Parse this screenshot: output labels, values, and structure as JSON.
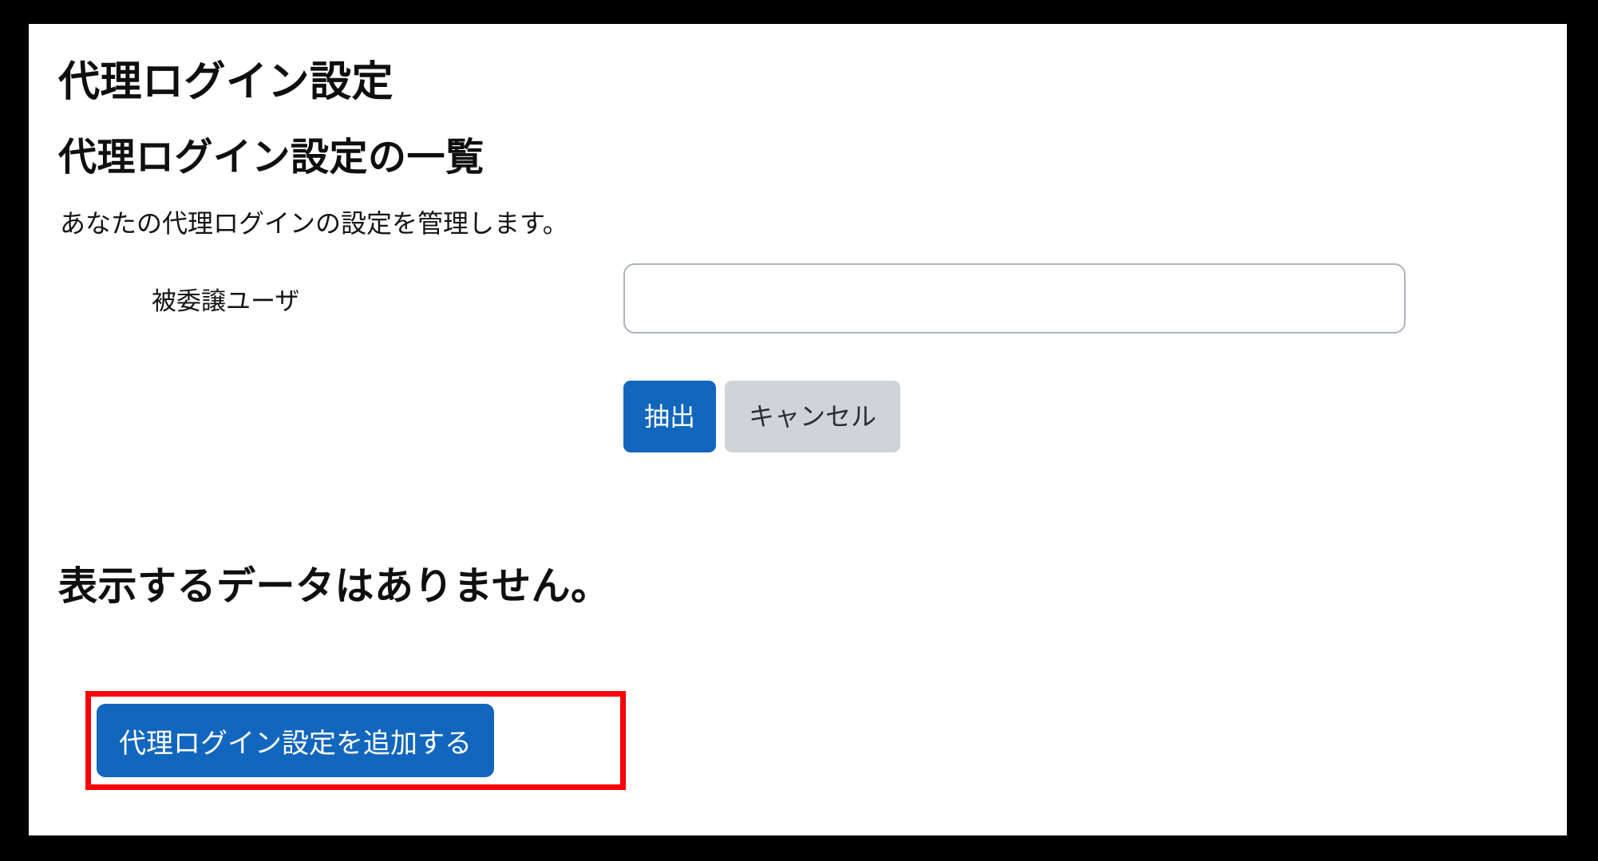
{
  "page": {
    "title": "代理ログイン設定",
    "section_title": "代理ログイン設定の一覧",
    "description": "あなたの代理ログインの設定を管理します。"
  },
  "filter": {
    "label": "被委譲ユーザ",
    "input_value": "",
    "input_placeholder": "",
    "submit_label": "抽出",
    "cancel_label": "キャンセル"
  },
  "list": {
    "empty_message": "表示するデータはありません。"
  },
  "actions": {
    "add_label": "代理ログイン設定を追加する"
  },
  "colors": {
    "primary": "#1266bd",
    "secondary": "#ced4da",
    "highlight": "#fb0007",
    "frame": "#000000",
    "text": "#0f0f0f",
    "input_border": "#aeb4bd"
  }
}
